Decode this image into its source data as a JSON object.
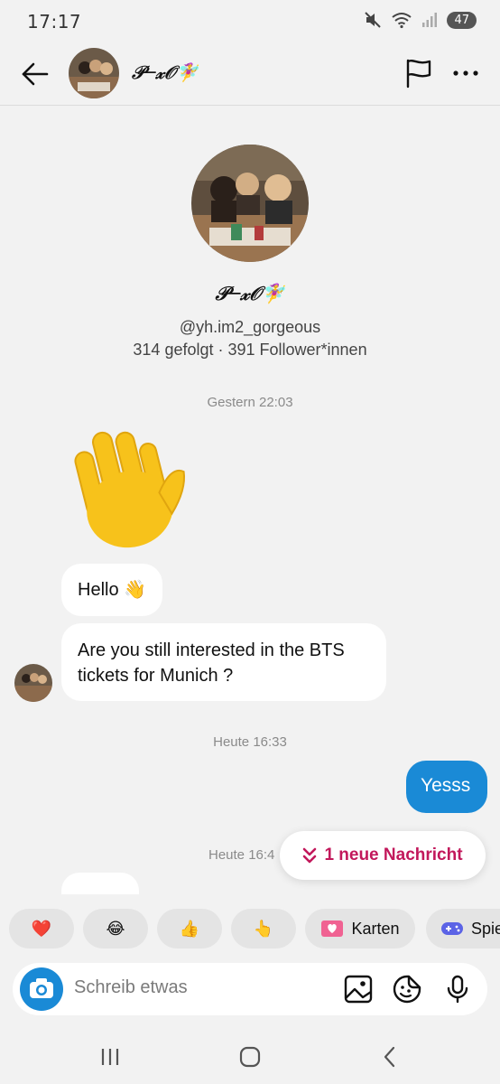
{
  "status_bar": {
    "time": "17:17",
    "battery": "47"
  },
  "header": {
    "name": "𝒫─𝓍𝒪🧚‍♀️"
  },
  "profile": {
    "name": "𝒫─𝓍𝒪🧚‍♀️",
    "handle": "@yh.im2_gorgeous",
    "stats": "314 gefolgt · 391 Follower*innen"
  },
  "messages": {
    "timestamp_1": "Gestern 22:03",
    "hello": "Hello 👋",
    "bts": "Are you still interested in the BTS tickets for Munich ?",
    "timestamp_2": "Heute 16:33",
    "yesss": "Yesss",
    "timestamp_3": "Heute 16:4"
  },
  "new_message_pill": {
    "label": "1 neue Nachricht"
  },
  "quick_reactions": {
    "heart": "❤️",
    "laugh": "😂",
    "thumbs": "👍",
    "point": "👆",
    "cards_label": "Karten",
    "games_label": "Spie"
  },
  "composer": {
    "placeholder": "Schreib etwas"
  },
  "colors": {
    "accent_blue": "#1a8ad6",
    "new_msg_pink": "#c2185b"
  }
}
